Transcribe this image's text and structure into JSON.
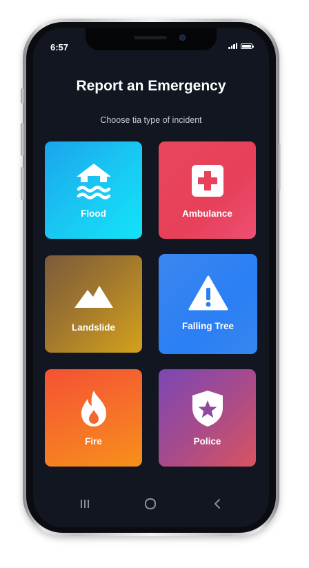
{
  "status_bar": {
    "time": "6:57"
  },
  "header": {
    "title": "Report an Emergency",
    "subtitle": "Choose tia type of incident"
  },
  "incident_types": [
    {
      "label": "Flood",
      "icon": "flood-house-icon",
      "color_from": "#1aa4ee",
      "color_to": "#12e3f8"
    },
    {
      "label": "Ambulance",
      "icon": "medical-cross-icon",
      "color_from": "#e9465a",
      "color_to": "#ee4f72"
    },
    {
      "label": "Landslide",
      "icon": "mountain-icon",
      "color_from": "#7c5a3a",
      "color_to": "#d4a21b"
    },
    {
      "label": "Falling Tree",
      "icon": "warning-triangle-icon",
      "color_from": "#3c86f0",
      "color_to": "#3787ee"
    },
    {
      "label": "Fire",
      "icon": "flame-icon",
      "color_from": "#f45232",
      "color_to": "#f7901a"
    },
    {
      "label": "Police",
      "icon": "shield-star-icon",
      "color_from": "#7a48b4",
      "color_to": "#d8555f"
    }
  ],
  "navigation_bar": {
    "items": [
      "recents-icon",
      "home-icon",
      "back-icon"
    ]
  },
  "colors": {
    "screen_background": "#121620",
    "text_primary": "#ffffff",
    "text_secondary": "#c9ccd3"
  }
}
